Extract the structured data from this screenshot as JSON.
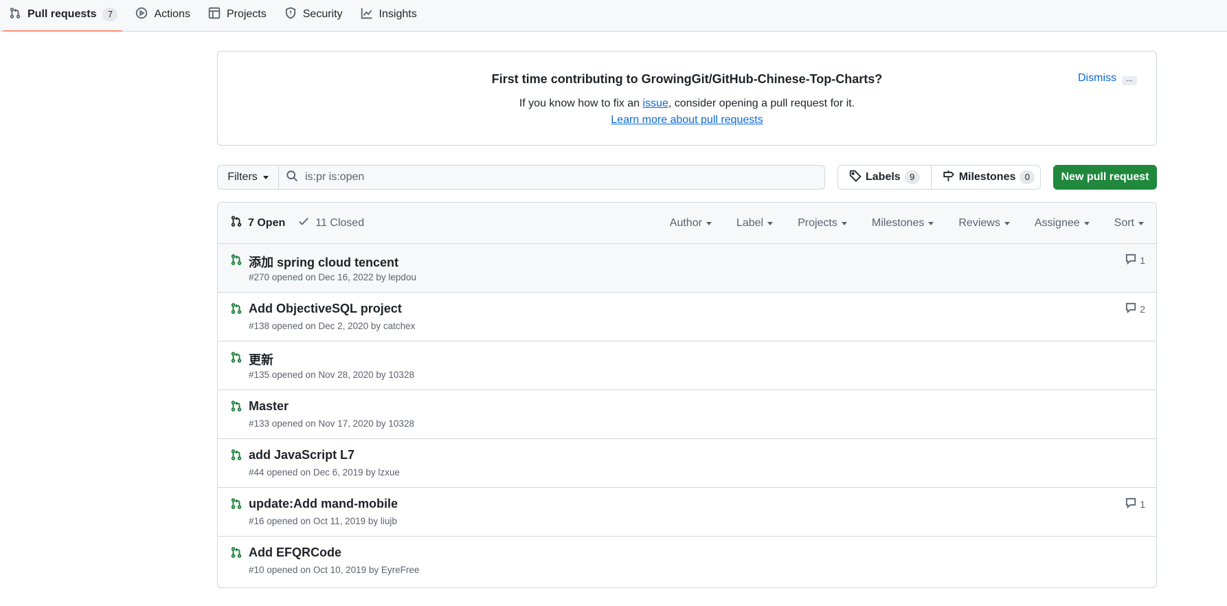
{
  "nav": {
    "tabs": [
      {
        "label": "Pull requests",
        "count": "7",
        "icon": "git-pull-request-icon"
      },
      {
        "label": "Actions",
        "icon": "play-icon"
      },
      {
        "label": "Projects",
        "icon": "table-icon"
      },
      {
        "label": "Security",
        "icon": "shield-icon"
      },
      {
        "label": "Insights",
        "icon": "graph-icon"
      }
    ]
  },
  "banner": {
    "title": "First time contributing to GrowingGit/GitHub-Chinese-Top-Charts?",
    "text_before": "If you know how to fix an ",
    "issue_link": "issue",
    "text_after": ", consider opening a pull request for it.",
    "learn_link": "Learn more about pull requests",
    "dismiss": "Dismiss",
    "more": "..."
  },
  "filter": {
    "filters_label": "Filters",
    "search_value": "is:pr is:open"
  },
  "labels": {
    "label": "Labels",
    "count": "9"
  },
  "milestones": {
    "label": "Milestones",
    "count": "0"
  },
  "new_pr_label": "New pull request",
  "list": {
    "open_label": "7 Open",
    "closed_label": "11 Closed",
    "sorters": [
      "Author",
      "Label",
      "Projects",
      "Milestones",
      "Reviews",
      "Assignee",
      "Sort"
    ],
    "items": [
      {
        "title": "添加 spring cloud tencent",
        "meta": "#270 opened on Dec 16, 2022 by lepdou",
        "comments": "1"
      },
      {
        "title": "Add ObjectiveSQL project",
        "meta": "#138 opened on Dec 2, 2020 by catchex",
        "comments": "2"
      },
      {
        "title": "更新",
        "meta": "#135 opened on Nov 28, 2020 by 10328",
        "comments": ""
      },
      {
        "title": "Master",
        "meta": "#133 opened on Nov 17, 2020 by 10328",
        "comments": ""
      },
      {
        "title": "add JavaScript L7",
        "meta": "#44 opened on Dec 6, 2019 by lzxue",
        "comments": ""
      },
      {
        "title": "update:Add mand-mobile",
        "meta": "#16 opened on Oct 11, 2019 by liujb",
        "comments": "1"
      },
      {
        "title": "Add EFQRCode",
        "meta": "#10 opened on Oct 10, 2019 by EyreFree",
        "comments": ""
      }
    ]
  },
  "colors": {
    "accent": "#fd8c73",
    "green": "#1f883d",
    "link": "#0969da",
    "open_icon": "#1a7f37"
  }
}
